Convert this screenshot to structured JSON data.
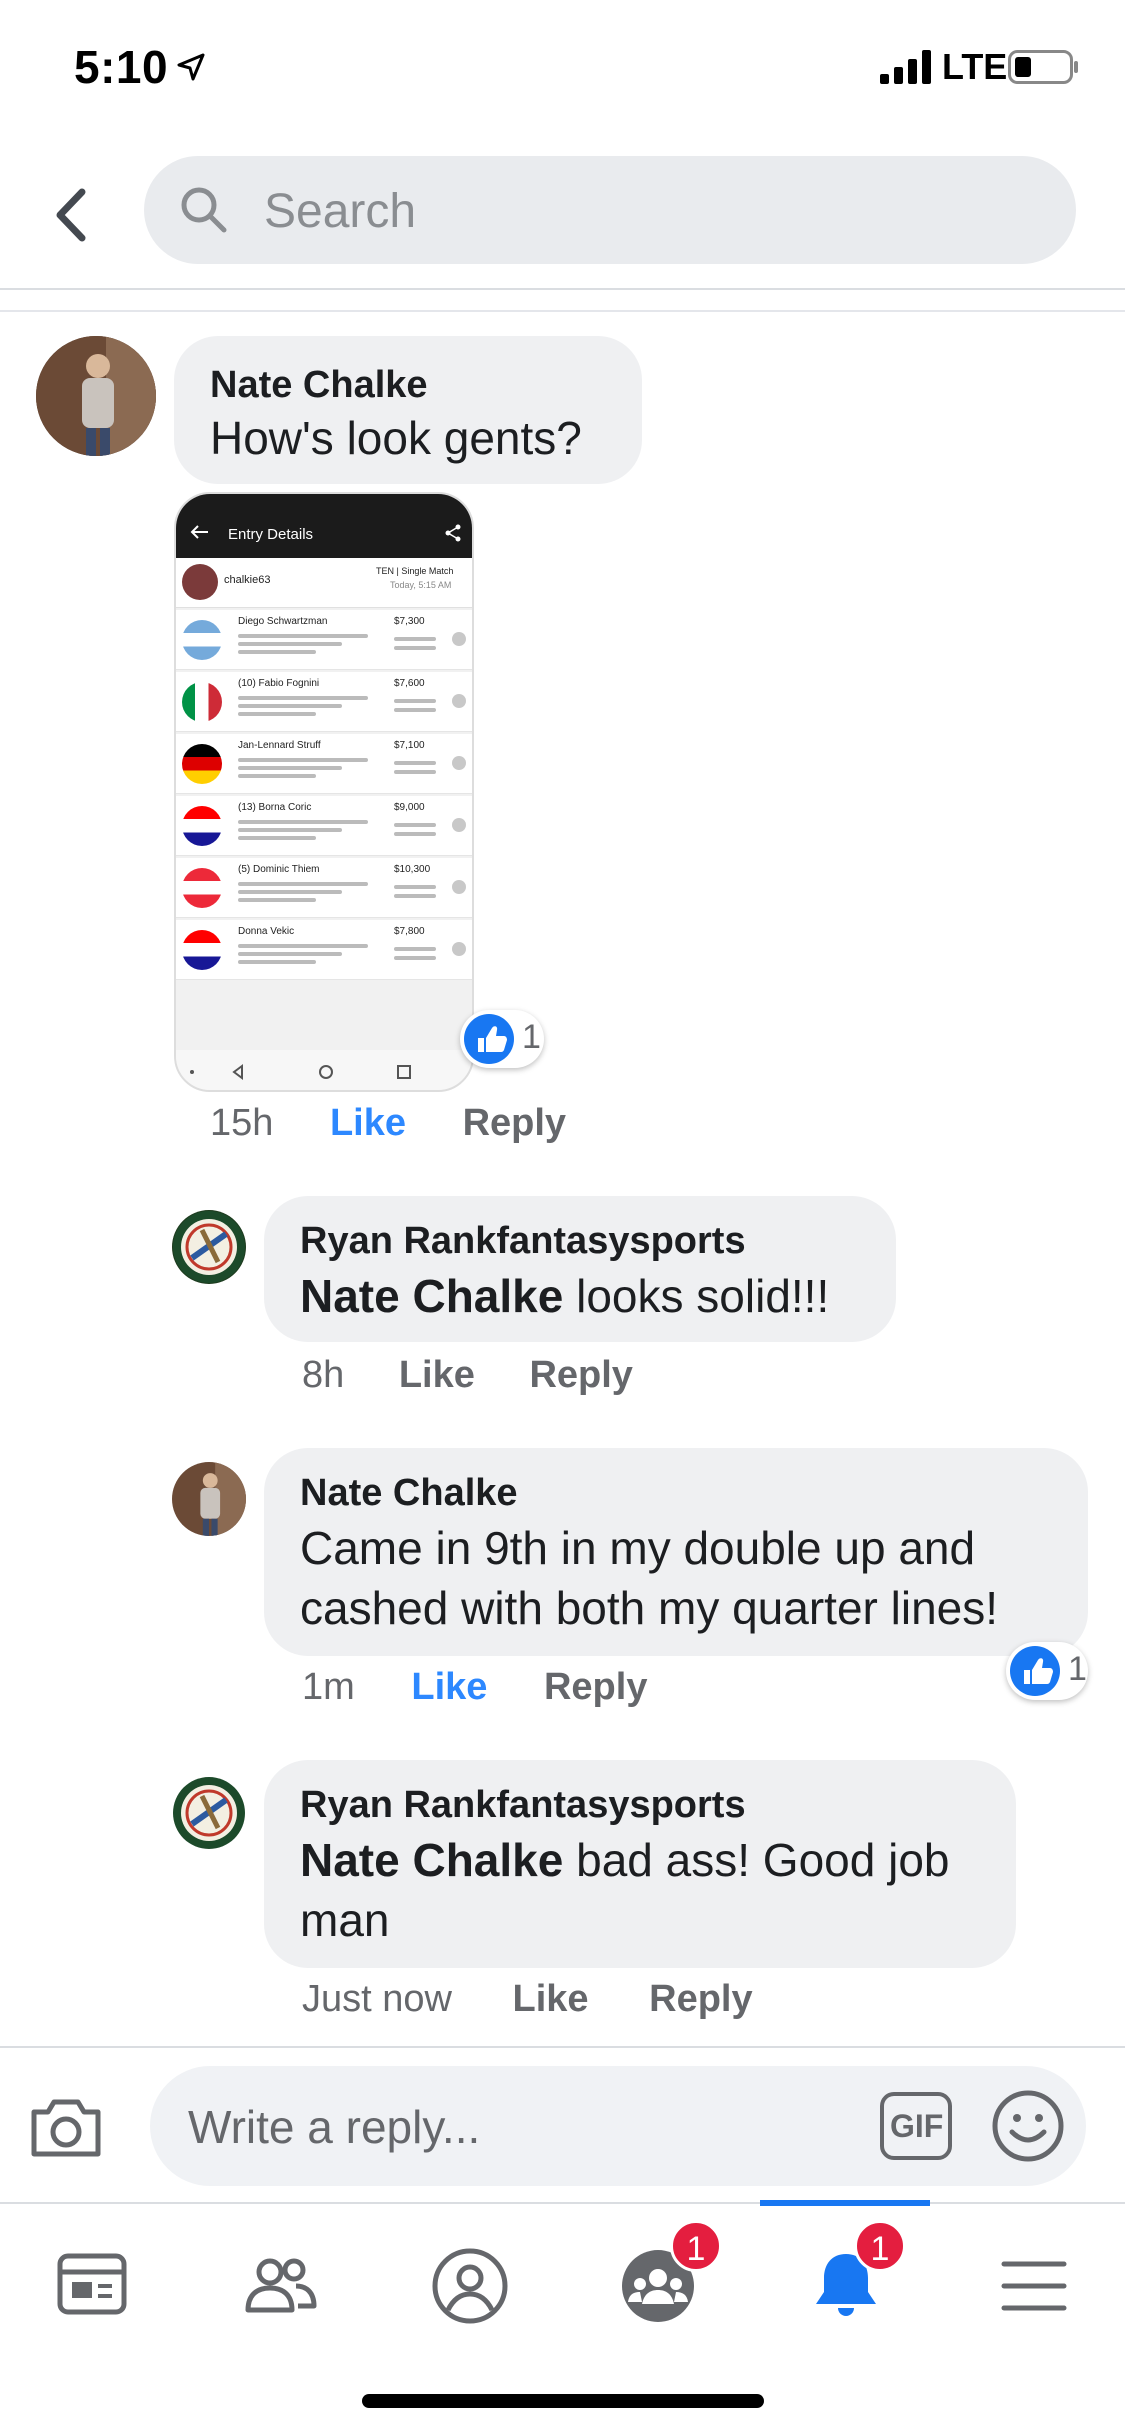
{
  "status_bar": {
    "time": "5:10",
    "network": "LTE"
  },
  "search": {
    "placeholder": "Search"
  },
  "comments": [
    {
      "author": "Nate Chalke",
      "text": "How's look gents?",
      "time": "15h",
      "like_label": "Like",
      "reply_label": "Reply",
      "reaction_count": "1",
      "liked": true
    },
    {
      "author": "Ryan Rankfantasysports",
      "mention": "Nate Chalke",
      "text": " looks solid!!!",
      "time": "8h",
      "like_label": "Like",
      "reply_label": "Reply"
    },
    {
      "author": "Nate Chalke",
      "text_line1": "Came in 9th in my double up and",
      "text_line2": "cashed with both my quarter lines!",
      "time": "1m",
      "like_label": "Like",
      "reply_label": "Reply",
      "reaction_count": "1",
      "liked": true
    },
    {
      "author": "Ryan Rankfantasysports",
      "mention": "Nate Chalke",
      "text_line1": " bad ass! Good job",
      "text_line2": "man",
      "time": "Just now",
      "like_label": "Like",
      "reply_label": "Reply"
    }
  ],
  "attachment": {
    "title": "Entry Details",
    "user": "chalkie63",
    "contest": "TEN | Single Match",
    "contest_time": "Today, 5:15 AM",
    "players": [
      {
        "name": "Diego Schwartzman",
        "price": "$7,300"
      },
      {
        "name": "(10) Fabio Fognini",
        "price": "$7,600"
      },
      {
        "name": "Jan-Lennard Struff",
        "price": "$7,100"
      },
      {
        "name": "(13) Borna Coric",
        "price": "$9,000"
      },
      {
        "name": "(5) Dominic Thiem",
        "price": "$10,300"
      },
      {
        "name": "Donna Vekic",
        "price": "$7,800"
      }
    ]
  },
  "composer": {
    "placeholder": "Write a reply...",
    "gif_label": "GIF"
  },
  "tabbar": {
    "groups_badge": "1",
    "notifications_badge": "1"
  },
  "colors": {
    "accent": "#1877f2",
    "badge": "#e41e3f",
    "bubble": "#eff0f2"
  }
}
